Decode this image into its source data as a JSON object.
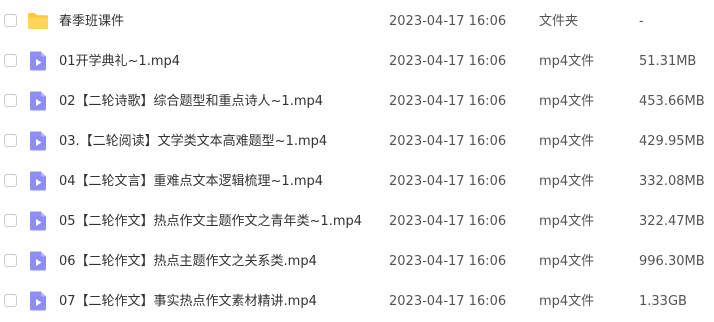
{
  "colors": {
    "folder": "#FFC73C",
    "video_icon": "#8E8CF5"
  },
  "files": [
    {
      "name": "春季班课件",
      "modified": "2023-04-17 16:06",
      "type": "文件夹",
      "size": "-",
      "icon": "folder-icon"
    },
    {
      "name": "01开学典礼~1.mp4",
      "modified": "2023-04-17 16:06",
      "type": "mp4文件",
      "size": "51.31MB",
      "icon": "video-file-icon"
    },
    {
      "name": "02【二轮诗歌】综合题型和重点诗人~1.mp4",
      "modified": "2023-04-17 16:06",
      "type": "mp4文件",
      "size": "453.66MB",
      "icon": "video-file-icon"
    },
    {
      "name": "03.【二轮阅读】文学类文本高难题型~1.mp4",
      "modified": "2023-04-17 16:06",
      "type": "mp4文件",
      "size": "429.95MB",
      "icon": "video-file-icon"
    },
    {
      "name": "04【二轮文言】重难点文本逻辑梳理~1.mp4",
      "modified": "2023-04-17 16:06",
      "type": "mp4文件",
      "size": "332.08MB",
      "icon": "video-file-icon"
    },
    {
      "name": "05【二轮作文】热点作文主题作文之青年类~1.mp4",
      "modified": "2023-04-17 16:06",
      "type": "mp4文件",
      "size": "322.47MB",
      "icon": "video-file-icon"
    },
    {
      "name": "06【二轮作文】热点主题作文之关系类.mp4",
      "modified": "2023-04-17 16:06",
      "type": "mp4文件",
      "size": "996.30MB",
      "icon": "video-file-icon"
    },
    {
      "name": "07【二轮作文】事实热点作文素材精讲.mp4",
      "modified": "2023-04-17 16:06",
      "type": "mp4文件",
      "size": "1.33GB",
      "icon": "video-file-icon"
    }
  ]
}
